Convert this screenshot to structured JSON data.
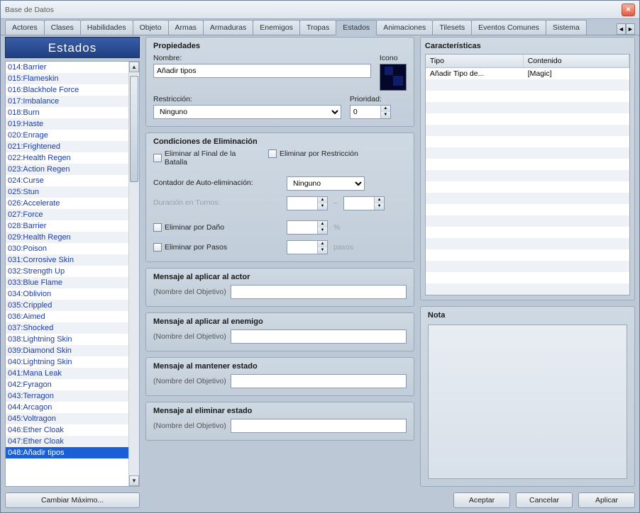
{
  "window": {
    "title": "Base de Datos"
  },
  "tabs": {
    "items": [
      {
        "label": "Actores"
      },
      {
        "label": "Clases"
      },
      {
        "label": "Habilidades"
      },
      {
        "label": "Objeto"
      },
      {
        "label": "Armas"
      },
      {
        "label": "Armaduras"
      },
      {
        "label": "Enemigos"
      },
      {
        "label": "Tropas"
      },
      {
        "label": "Estados"
      },
      {
        "label": "Animaciones"
      },
      {
        "label": "Tilesets"
      },
      {
        "label": "Eventos Comunes"
      },
      {
        "label": "Sistema"
      }
    ],
    "active": 8,
    "left_arrow": "◄",
    "right_arrow": "►"
  },
  "left": {
    "header": "Estados",
    "items": [
      "014:Barrier",
      "015:Flameskin",
      "016:Blackhole Force",
      "017:Imbalance",
      "018:Burn",
      "019:Haste",
      "020:Enrage",
      "021:Frightened",
      "022:Health Regen",
      "023:Action Regen",
      "024:Curse",
      "025:Stun",
      "026:Accelerate",
      "027:Force",
      "028:Barrier",
      "029:Health Regen",
      "030:Poison",
      "031:Corrosive Skin",
      "032:Strength Up",
      "033:Blue Flame",
      "034:Oblivion",
      "035:Crippled",
      "036:Aimed",
      "037:Shocked",
      "038:Lightning Skin",
      "039:Diamond Skin",
      "040:Lightning Skin",
      "041:Mana Leak",
      "042:Fyragon",
      "043:Terragon",
      "044:Arcagon",
      "045:Voltragon",
      "046:Ether Cloak",
      "047:Ether Cloak",
      "048:Añadir tipos"
    ],
    "selected_index": 34,
    "change_max": "Cambiar Máximo..."
  },
  "props": {
    "title": "Propiedades",
    "name_label": "Nombre:",
    "name_value": "Añadir tipos",
    "icon_label": "Icono",
    "restriction_label": "Restricción:",
    "restriction_value": "Ninguno",
    "priority_label": "Prioridad:",
    "priority_value": "0"
  },
  "elim": {
    "title": "Condiciones de Eliminación",
    "end_battle": "Eliminar al Final de la Batalla",
    "by_restriction": "Eliminar por Restricción",
    "auto_label": "Contador de Auto-eliminación:",
    "auto_value": "Ninguno",
    "turns_label": "Duración en Turnos:",
    "tilde": "~",
    "by_damage": "Eliminar por Daño",
    "damage_unit": "%",
    "by_steps": "Eliminar por Pasos",
    "steps_unit": "pasos"
  },
  "msg_actor": {
    "title": "Mensaje al aplicar al actor",
    "hint": "(Nombre del Objetivo)"
  },
  "msg_enemy": {
    "title": "Mensaje al aplicar al enemigo",
    "hint": "(Nombre del Objetivo)"
  },
  "msg_keep": {
    "title": "Mensaje al mantener estado",
    "hint": "(Nombre del Objetivo)"
  },
  "msg_remove": {
    "title": "Mensaje al eliminar estado",
    "hint": "(Nombre del Objetivo)"
  },
  "chars": {
    "title": "Características",
    "col_type": "Tipo",
    "col_content": "Contenido",
    "rows": [
      {
        "type": "Añadir Tipo de...",
        "content": "[Magic]"
      }
    ]
  },
  "note": {
    "title": "Nota"
  },
  "footer": {
    "ok": "Aceptar",
    "cancel": "Cancelar",
    "apply": "Aplicar"
  }
}
